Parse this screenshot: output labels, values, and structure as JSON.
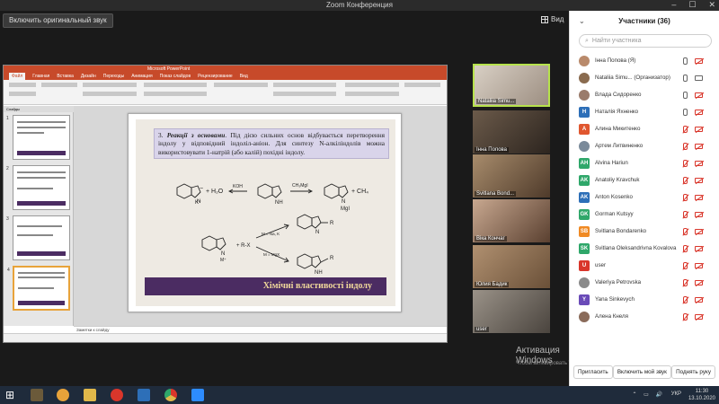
{
  "window": {
    "title": "Zoom Конференция"
  },
  "toolbar": {
    "original_sound": "Включить оригинальный звук",
    "view": "Вид"
  },
  "ppt": {
    "tabs": [
      "Файл",
      "Главная",
      "Вставка",
      "Дизайн",
      "Переходы",
      "Анимация",
      "Показ слайдов",
      "Рецензирование",
      "Вид"
    ],
    "thumb_tab": "Слайды",
    "notes": "Заметки к слайду",
    "slide_numbers": [
      "1",
      "2",
      "3",
      "4"
    ]
  },
  "slide": {
    "text_num": "3.",
    "text_bold": "Реакції з основами",
    "text_body": ". Під дією сильних основ відбувається перетворення індолу у відповідний індоліл-аніон. Для синтезу N-алкіліндолів можна використовувати 1-натрій (або калій) похідні індолу.",
    "footer": "Хімічні властивості індолу",
    "chem": {
      "koh": "KOH",
      "water": "+ H₂O",
      "k": "K⁺",
      "ch3mgi": "CH₃MgI",
      "methane": "+ CH₄",
      "mgi": "MgI",
      "rx": "+ R-X",
      "m1": "M = Na, K",
      "m2": "M = MgX",
      "minus": "−",
      "mplus": "M⁺",
      "nh": "NH",
      "n": "N",
      "r": "R"
    }
  },
  "videos": [
    {
      "name": "Nataliia Simu..."
    },
    {
      "name": "Інна Попова"
    },
    {
      "name": "Svitlana Bond..."
    },
    {
      "name": "Вікa Кончаг"
    },
    {
      "name": "Юлия Бадик"
    },
    {
      "name": "user"
    }
  ],
  "participants": {
    "title": "Участники (36)",
    "search_placeholder": "Найти участника",
    "list": [
      {
        "initial": "",
        "name": "Інна Попова (Я)",
        "color": "#b98a6b",
        "mic": "on",
        "cam": "muted"
      },
      {
        "initial": "",
        "name": "Nataliia Simu... (Организатор)",
        "color": "#8a6b4f",
        "mic": "on",
        "cam": "on"
      },
      {
        "initial": "",
        "name": "Влада Сидоренко",
        "color": "#9a7b6b",
        "mic": "on",
        "cam": "muted"
      },
      {
        "initial": "Н",
        "name": "Наталія Яхненко",
        "color": "#2d6fb8",
        "mic": "on",
        "cam": "muted"
      },
      {
        "initial": "А",
        "name": "Алина Микитенко",
        "color": "#e0572f",
        "mic": "muted",
        "cam": "muted"
      },
      {
        "initial": "",
        "name": "Артем Литвиненко",
        "color": "#7a8a9a",
        "mic": "muted",
        "cam": "muted"
      },
      {
        "initial": "AH",
        "name": "Alvina Hariun",
        "color": "#2fa76a",
        "mic": "muted",
        "cam": "muted"
      },
      {
        "initial": "AK",
        "name": "Anatoliy Kravchuk",
        "color": "#2fa76a",
        "mic": "muted",
        "cam": "muted"
      },
      {
        "initial": "AK",
        "name": "Anton Kosenko",
        "color": "#2d6fb8",
        "mic": "muted",
        "cam": "muted"
      },
      {
        "initial": "GK",
        "name": "Gorman Kutsyy",
        "color": "#2fa76a",
        "mic": "muted",
        "cam": "muted"
      },
      {
        "initial": "SB",
        "name": "Svitlana Bondarenko",
        "color": "#f08a24",
        "mic": "muted",
        "cam": "muted"
      },
      {
        "initial": "SK",
        "name": "Svitlana Oleksandrivna Kovalova",
        "color": "#2fa76a",
        "mic": "muted",
        "cam": "muted"
      },
      {
        "initial": "U",
        "name": "user",
        "color": "#d9362b",
        "mic": "muted",
        "cam": "muted"
      },
      {
        "initial": "",
        "name": "Valeriya Petrovska",
        "color": "#8a8a8a",
        "mic": "muted",
        "cam": "muted"
      },
      {
        "initial": "Y",
        "name": "Yana Sinkevych",
        "color": "#6a4bb8",
        "mic": "muted",
        "cam": "muted"
      },
      {
        "initial": "",
        "name": "Алена Кнеля",
        "color": "#8a6b5a",
        "mic": "muted",
        "cam": "muted"
      }
    ],
    "invite": "Пригласить",
    "unmute_me": "Включить мой звук",
    "raise_hand": "Поднять руку"
  },
  "activation": {
    "title": "Активация Windows",
    "text": "Чтобы активировать Windows, перейдите к параметрам компьютера."
  },
  "taskbar": {
    "lang": "УКР",
    "time": "11:30",
    "date": "13.10.2020"
  }
}
